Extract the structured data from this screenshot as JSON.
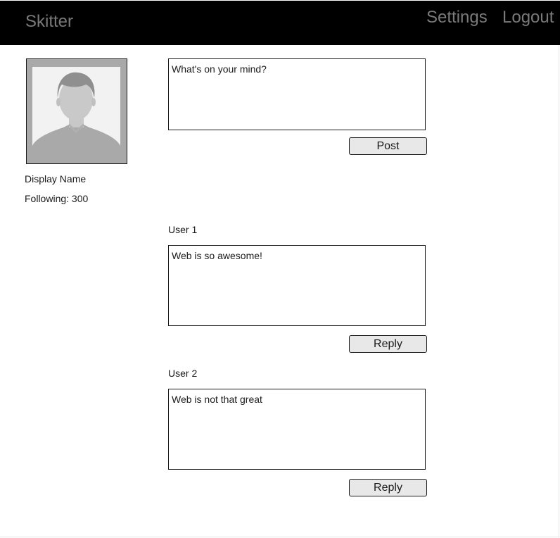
{
  "header": {
    "brand": "Skitter",
    "nav": {
      "settings": "Settings",
      "logout": "Logout"
    }
  },
  "profile": {
    "avatar_icon": "user-silhouette-icon",
    "display_name": "Display Name",
    "following": "Following: 300"
  },
  "composer": {
    "placeholder": "What's on your mind?",
    "post_label": "Post"
  },
  "feed": [
    {
      "user": "User 1",
      "text": "Web is so awesome!",
      "reply_label": "Reply"
    },
    {
      "user": "User 2",
      "text": "Web is not that great",
      "reply_label": "Reply"
    }
  ],
  "colors": {
    "header_bg": "#000000",
    "header_text": "#7a7a7a",
    "button_bg": "#e8e8e8",
    "avatar_bg": "#a9a9a9"
  }
}
